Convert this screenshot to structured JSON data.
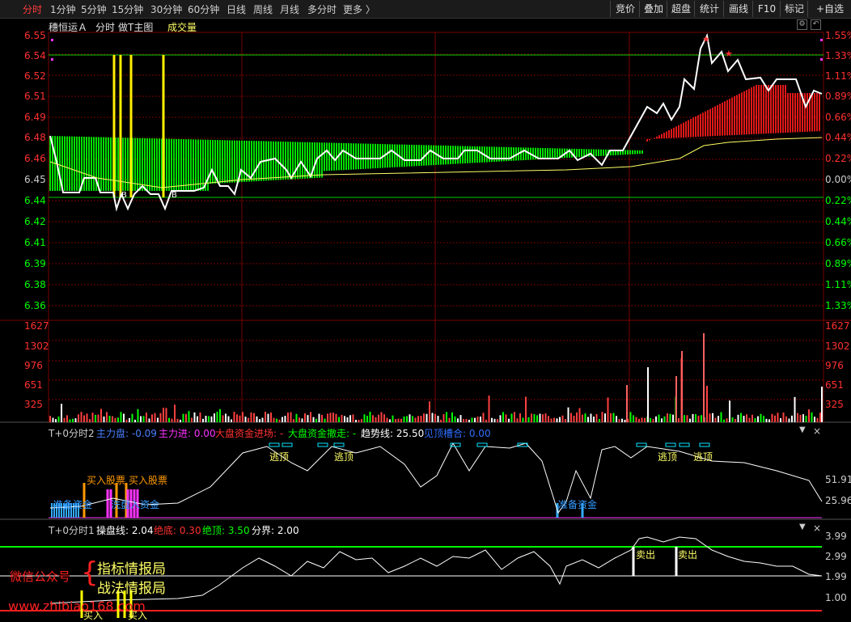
{
  "tabs": [
    "分时",
    "1分钟",
    "5分钟",
    "15分钟",
    "30分钟",
    "60分钟",
    "日线",
    "周线",
    "月线",
    "多分时",
    "更多 〉"
  ],
  "right_buttons": [
    "竞价",
    "叠加",
    "超盘",
    "统计",
    "画线",
    "F10",
    "标记",
    "+自选"
  ],
  "chart_header": {
    "stock": "穗恒运Ａ",
    "mode": "分时",
    "main": "做T主图",
    "vol": "成交量"
  },
  "price_axis": [
    "6.55",
    "6.54",
    "6.52",
    "6.51",
    "6.49",
    "6.48",
    "6.46",
    "6.45",
    "6.44",
    "6.42",
    "6.41",
    "6.39",
    "6.38",
    "6.36"
  ],
  "pct_axis": [
    "1.55%",
    "1.33%",
    "1.11%",
    "0.89%",
    "0.66%",
    "0.44%",
    "0.22%",
    "0.00%",
    "0.22%",
    "0.44%",
    "0.66%",
    "0.89%",
    "1.11%",
    "1.33%"
  ],
  "vol_axis": [
    "1627",
    "1302",
    "976",
    "651",
    "325"
  ],
  "marks": {
    "buy": "B",
    "star": "★"
  },
  "panel2": {
    "title": "T+0分时2",
    "f1": "主力盘: -0.09",
    "f2": "主力进: 0.00",
    "f3": "大盘资金进场: -",
    "f4": "大盘资金撤走: -",
    "f5": "趋势线: 25.50",
    "f6": "见顶槽合: 0.00",
    "axis": [
      "51.91",
      "25.96"
    ],
    "labels": {
      "escape": "逃顶",
      "buy": "买入股票",
      "prep": "准备资金",
      "wash": "洗盘入资金"
    }
  },
  "panel3": {
    "title": "T+0分时1",
    "f1": "操盘线: 2.04",
    "f2": "绝底: 0.30",
    "f3": "绝顶: 3.50",
    "f4": "分界: 2.00",
    "axis": [
      "3.99",
      "2.99",
      "1.99",
      "1.00"
    ],
    "sell": "卖出",
    "buy": "买入"
  },
  "watermark": {
    "line1": "微信公众号",
    "brace": "{",
    "name1": "指标情报局",
    "name2": "战法情报局",
    "url": "www.zhibiao168.com"
  },
  "colors": {
    "up": "#ff3030",
    "down": "#00ff00",
    "price": "#ffffff",
    "avg": "#ffff66",
    "grid": "#7a0000"
  }
}
